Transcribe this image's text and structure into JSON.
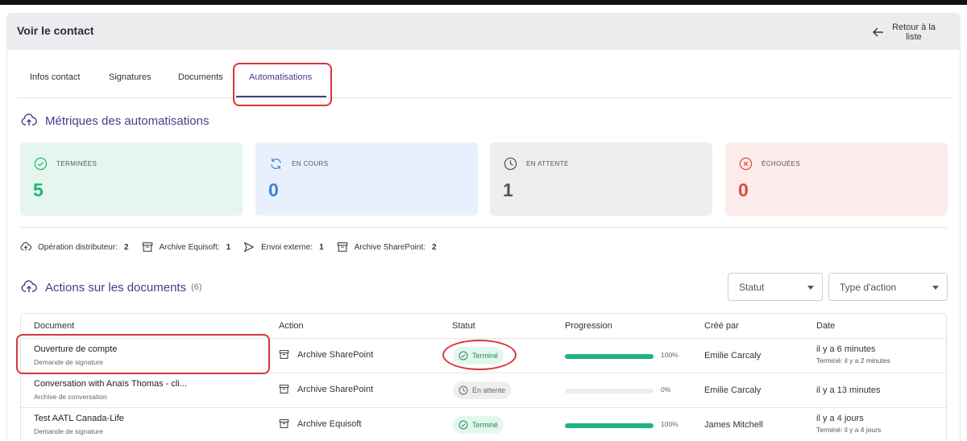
{
  "header": {
    "title": "Voir le contact",
    "back_label": "Retour à la liste"
  },
  "tabs": [
    {
      "label": "Infos contact"
    },
    {
      "label": "Signatures"
    },
    {
      "label": "Documents"
    },
    {
      "label": "Automatisations",
      "active": true
    }
  ],
  "metrics_section": {
    "title": "Métriques des automatisations",
    "cards": [
      {
        "label": "TERMINÉES",
        "value": "5",
        "icon": "check-circle-icon",
        "color": "#1fb57a",
        "bg": "#e5f6ee"
      },
      {
        "label": "EN COURS",
        "value": "0",
        "icon": "refresh-icon",
        "color": "#3b82d6",
        "bg": "#e9f0fd"
      },
      {
        "label": "EN ATTENTE",
        "value": "1",
        "icon": "clock-icon",
        "color": "#555555",
        "bg": "#eeeeef"
      },
      {
        "label": "ÉCHOUÉES",
        "value": "0",
        "icon": "x-circle-icon",
        "color": "#e0483e",
        "bg": "#fdecec"
      }
    ]
  },
  "stats": [
    {
      "label": "Opération distributeur:",
      "value": "2",
      "icon": "cloud-upload-icon"
    },
    {
      "label": "Archive Equisoft:",
      "value": "1",
      "icon": "archive-icon"
    },
    {
      "label": "Envoi externe:",
      "value": "1",
      "icon": "send-icon"
    },
    {
      "label": "Archive SharePoint:",
      "value": "2",
      "icon": "archive-icon"
    }
  ],
  "documents_section": {
    "title": "Actions sur les documents",
    "count": "(6)",
    "filters": {
      "status": "Statut",
      "action_type": "Type d'action"
    }
  },
  "table": {
    "columns": [
      "Document",
      "Action",
      "Statut",
      "Progression",
      "Créé par",
      "Date"
    ],
    "rows": [
      {
        "title": "Ouverture de compte",
        "subtitle": "Demande de signature",
        "action": "Archive SharePoint",
        "status": "Terminé",
        "status_type": "done",
        "progress": 100,
        "progress_label": "100%",
        "created_by": "Emilie Carcaly",
        "date": "il y a 6 minutes",
        "date_detail": "Terminé: il y a 2 minutes"
      },
      {
        "title": "Conversation with Anaïs Thomas - cli...",
        "subtitle": "Archive de conversation",
        "action": "Archive SharePoint",
        "status": "En attente",
        "status_type": "wait",
        "progress": 0,
        "progress_label": "0%",
        "created_by": "Emilie Carcaly",
        "date": "il y a 13 minutes",
        "date_detail": ""
      },
      {
        "title": "Test AATL Canada-Life",
        "subtitle": "Demande de signature",
        "action": "Archive Equisoft",
        "status": "Terminé",
        "status_type": "done",
        "progress": 100,
        "progress_label": "100%",
        "created_by": "James Mitchell",
        "date": "il y a 4 jours",
        "date_detail": "Terminé: il y a 4 jours"
      }
    ]
  }
}
